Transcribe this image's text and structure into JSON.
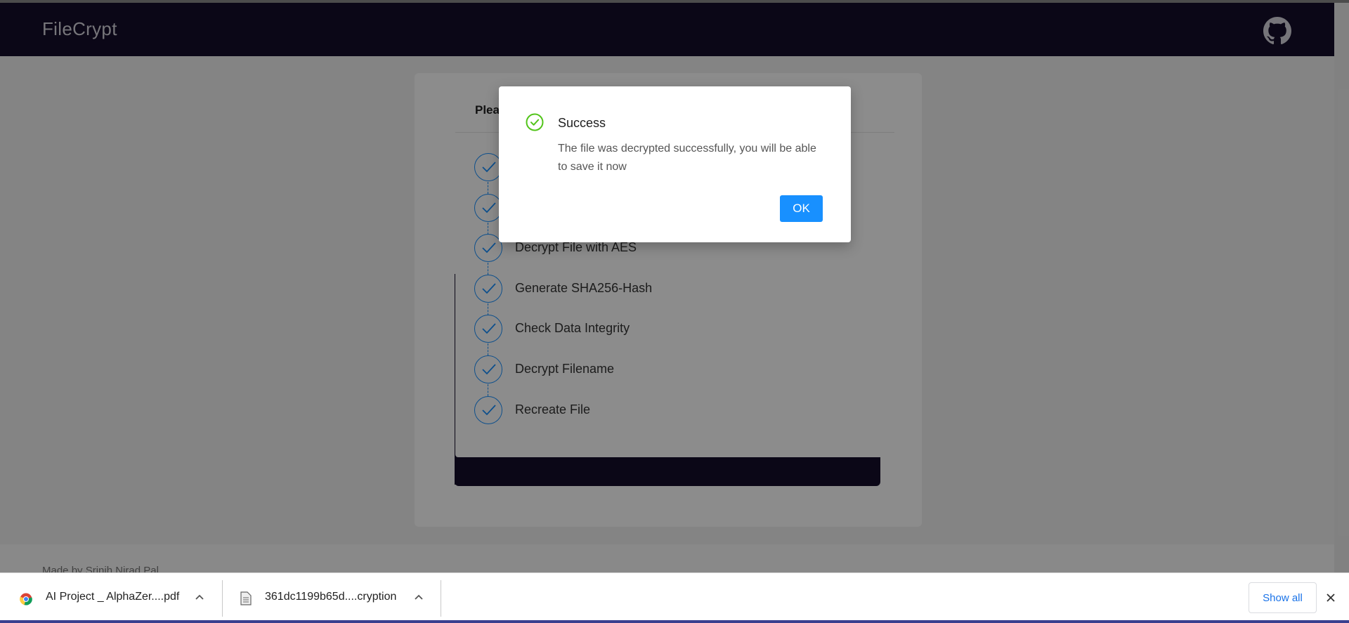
{
  "app": {
    "title": "FileCrypt",
    "github_icon": "github-icon"
  },
  "progress_modal": {
    "title": "Plea",
    "steps": [
      {
        "label": ""
      },
      {
        "label": ""
      },
      {
        "label": "Decrypt File with AES"
      },
      {
        "label": "Generate SHA256-Hash"
      },
      {
        "label": "Check Data Integrity"
      },
      {
        "label": "Decrypt Filename"
      },
      {
        "label": "Recreate File"
      }
    ]
  },
  "footer": {
    "text": "Made by Srinih Nirad Pal"
  },
  "dialog": {
    "title": "Success",
    "message": "The file was decrypted successfully, you will be able to save it now",
    "ok_label": "OK",
    "icon": "check-circle-icon"
  },
  "downloads": {
    "items": [
      {
        "name": "AI Project _ AlphaZer....pdf",
        "icon": "chrome-icon"
      },
      {
        "name": "361dc1199b65d....cryption",
        "icon": "file-icon"
      }
    ],
    "show_all_label": "Show all"
  },
  "colors": {
    "accent": "#1890ff",
    "nav": "#150e2a",
    "success": "#52c41a"
  }
}
